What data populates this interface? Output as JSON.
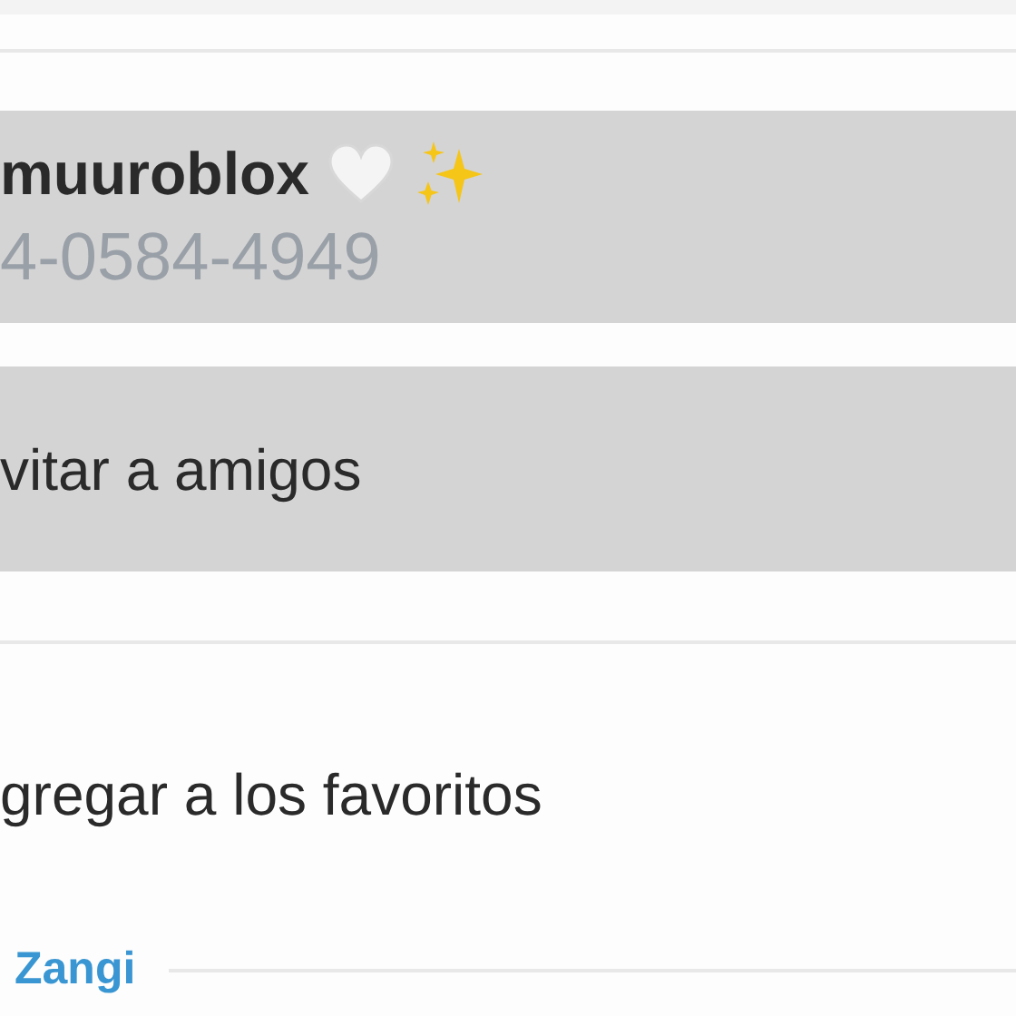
{
  "contact": {
    "name": "muuroblox",
    "phone": "4-0584-4949",
    "selected": true
  },
  "actions": [
    {
      "label": "vitar a amigos",
      "selected": true
    },
    {
      "label": "gregar a los favoritos",
      "selected": false
    }
  ],
  "section_header": "Zangi"
}
